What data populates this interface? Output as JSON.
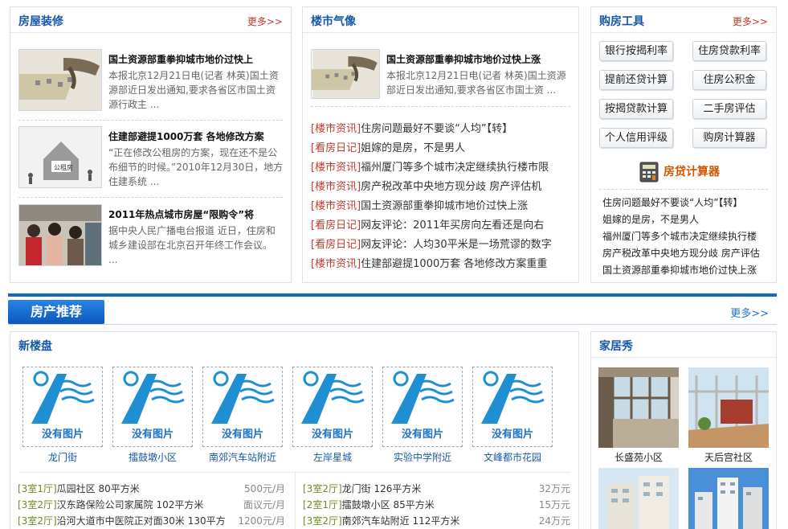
{
  "decor": {
    "title": "房屋装修",
    "more": "更多>>",
    "items": [
      {
        "title": "国土资源部重拳抑城市地价过快上",
        "desc": "本报北京12月21日电(记者 林英)国土资源部近日发出通知,要求各省区市国土资源行政主 ..."
      },
      {
        "title": "住建部避提1000万套 各地修改方案",
        "desc": "“正在修改公租房的方案，现在还不是公布细节的时候。”2010年12月30日，地方住建系统 ..."
      },
      {
        "title": "2011年热点城市房屋“限购令”将",
        "desc": "据中央人民广播电台报道 近日，住房和城乡建设部在北京召开年终工作会议。 ..."
      }
    ]
  },
  "market": {
    "title": "楼市气像",
    "feature": {
      "title": "国土资源部重拳抑城市地价过快上涨",
      "desc": "本报北京12月21日电(记者 林英)国土资源部近日发出通知,要求各省区市国土资 ..."
    },
    "list": [
      {
        "tag": "[楼市资讯]",
        "text": "住房问题最好不要谈“人均”【转】"
      },
      {
        "tag": "[看房日记]",
        "text": "姐嫁的是房，不是男人"
      },
      {
        "tag": "[楼市资讯]",
        "text": "福州厦门等多个城市决定继续执行楼市限"
      },
      {
        "tag": "[楼市资讯]",
        "text": "房产税改革中央地方现分歧 房产评估机"
      },
      {
        "tag": "[楼市资讯]",
        "text": "国土资源部重拳抑城市地价过快上涨"
      },
      {
        "tag": "[看房日记]",
        "text": "网友评论：2011年买房向左看还是向右"
      },
      {
        "tag": "[看房日记]",
        "text": "网友评论：人均30平米是一场荒谬的数字"
      },
      {
        "tag": "[楼市资讯]",
        "text": "住建部避提1000万套 各地修改方案重重"
      }
    ]
  },
  "tools": {
    "title": "购房工具",
    "more": "更多>>",
    "buttons": [
      "银行按揭利率",
      "住房贷款利率",
      "提前还贷计算",
      "住房公积金",
      "按揭贷款计算",
      "二手房评估",
      "个人信用评级",
      "购房计算器"
    ],
    "calc_label": "房贷计算器",
    "list": [
      "住房问题最好不要谈“人均”【转】",
      "姐嫁的是房，不是男人",
      "福州厦门等多个城市决定继续执行楼",
      "房产税改革中央地方现分歧 房产评估",
      "国土资源部重拳抑城市地价过快上涨"
    ]
  },
  "recommend": {
    "title": "房产推荐",
    "more": "更多>>"
  },
  "newhomes": {
    "title": "新楼盘",
    "no_image": "没有图片",
    "items": [
      "龙门街",
      "擂鼓墩小区",
      "南郊汽车站附近",
      "左岸星城",
      "实验中学附近",
      "文峰都市花园"
    ],
    "rent_left": [
      {
        "tag": "[3室1厅]",
        "text": "瓜园社区 80平方米",
        "price": "500元/月"
      },
      {
        "tag": "[3室2厅]",
        "text": "汉东路保险公司家属院 102平方米",
        "price": "面议元/月"
      },
      {
        "tag": "[3室2厅]",
        "text": "沿河大道市中医院正对面30米 130平方",
        "price": "1200元/月"
      }
    ],
    "rent_right": [
      {
        "tag": "[3室2厅]",
        "text": "龙门街 126平方米",
        "price": "32万元"
      },
      {
        "tag": "[2室1厅]",
        "text": "擂鼓墩小区 85平方米",
        "price": "15万元"
      },
      {
        "tag": "[3室2厅]",
        "text": "南郊汽车站附近 112平方米",
        "price": "24万元"
      }
    ]
  },
  "homeshow": {
    "title": "家居秀",
    "items": [
      "长盛苑小区",
      "天后宫社区",
      "",
      ""
    ]
  }
}
